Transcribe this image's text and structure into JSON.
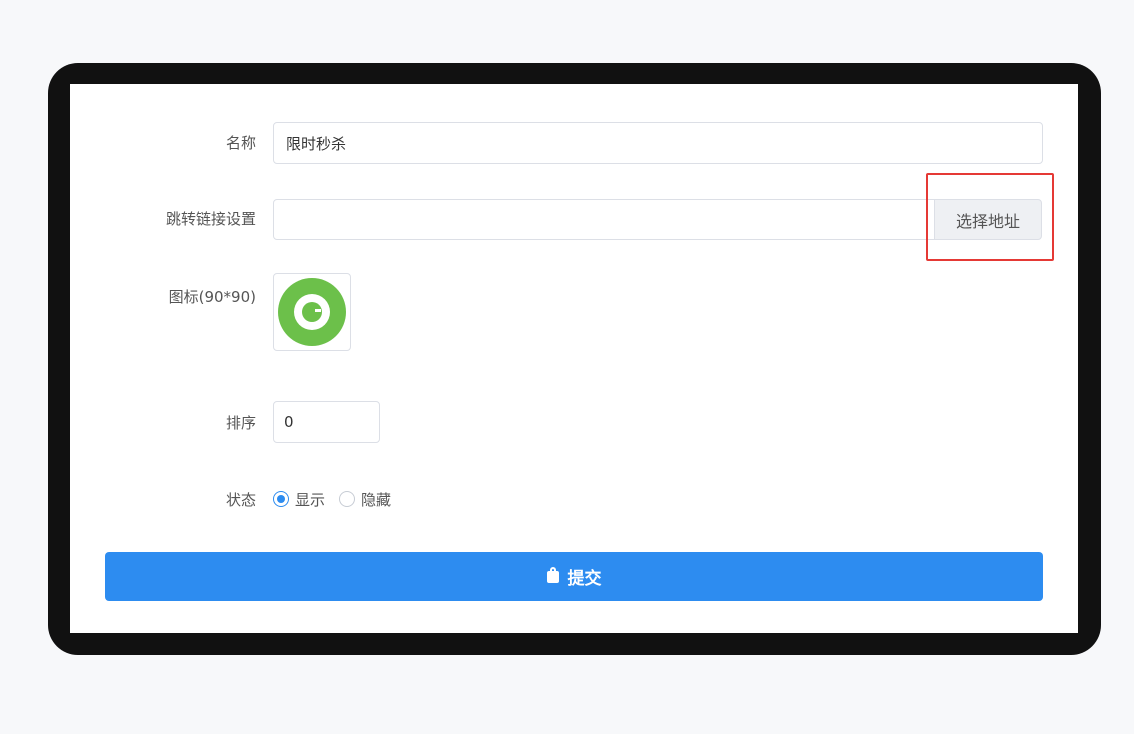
{
  "form": {
    "name_label": "名称",
    "name_value": "限时秒杀",
    "link_label": "跳转链接设置",
    "link_value": "",
    "link_button": "选择地址",
    "icon_label": "图标(90*90)",
    "sort_label": "排序",
    "sort_value": "0",
    "status_label": "状态",
    "status_options": [
      "显示",
      "隐藏"
    ],
    "status_selected": "显示",
    "submit_label": "提交"
  },
  "colors": {
    "accent": "#2d8cf0",
    "highlight": "#e53935",
    "icon_green": "#6cc04a"
  },
  "icons": {
    "submit": "bag-icon",
    "uploaded": "green-ring-icon"
  }
}
